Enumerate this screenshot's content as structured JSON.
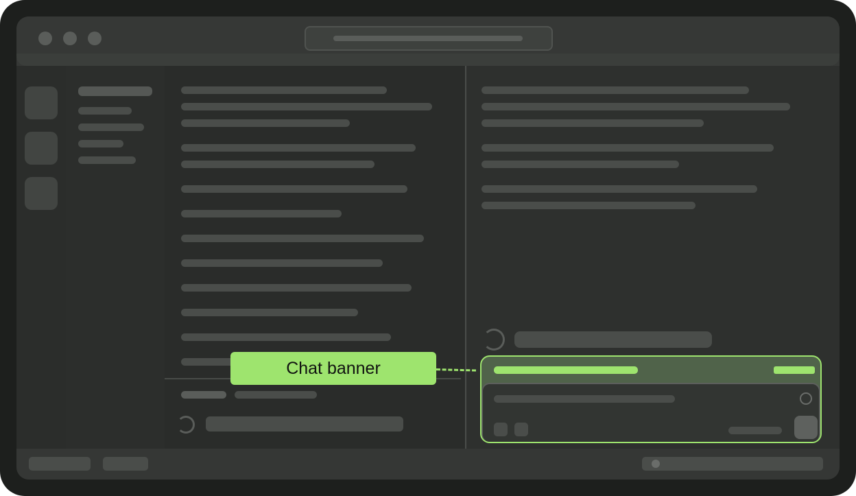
{
  "callout": {
    "label": "Chat banner"
  },
  "colors": {
    "frame": "#1d1f1d",
    "window": "#2e302e",
    "accent": "#9ee46e",
    "placeholder": "#4a4d4a"
  },
  "icons": {
    "window_controls": [
      "close-dot-icon",
      "minimize-dot-icon",
      "maximize-dot-icon"
    ],
    "spinner": "loading-spinner-icon",
    "status": "radio-ring-icon"
  }
}
